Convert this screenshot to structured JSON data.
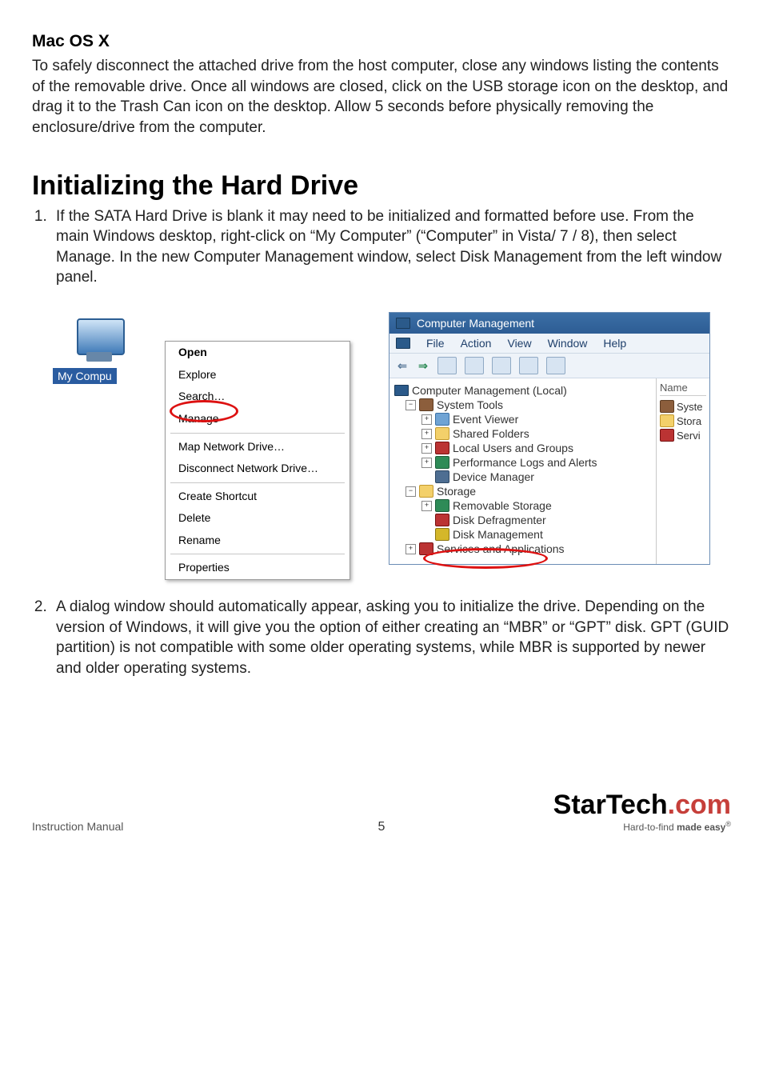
{
  "section1_title": "Mac OS X",
  "section1_body": "To safely disconnect the attached drive from the host computer, close any windows listing the contents of the removable drive. Once all windows are closed, click on the USB storage icon on the desktop, and drag it to the Trash Can icon on the desktop. Allow 5 seconds before physically removing the enclosure/drive from the computer.",
  "main_title": "Initializing the Hard Drive",
  "step1": "If the SATA Hard Drive is blank it may need to be initialized and formatted before use. From the main Windows desktop, right-click on “My Computer” (“Computer” in Vista/ 7 / 8), then select Manage. In the new Computer Management window, select Disk Management from the left window panel.",
  "step2": "A dialog window should automatically appear, asking you to initialize the drive. Depending on the version of Windows, it will give you the option of either creating an “MBR” or “GPT” disk. GPT (GUID partition) is not compatible with some older operating systems, while MBR is supported by newer and older operating systems.",
  "mycomputer_label": "My Compu",
  "context_menu": {
    "open": "Open",
    "explore": "Explore",
    "search": "Search…",
    "manage": "Manage",
    "map": "Map Network Drive…",
    "disconnect": "Disconnect Network Drive…",
    "shortcut": "Create Shortcut",
    "delete": "Delete",
    "rename": "Rename",
    "properties": "Properties"
  },
  "mgmt": {
    "title": "Computer Management",
    "menu": {
      "file": "File",
      "action": "Action",
      "view": "View",
      "window": "Window",
      "help": "Help"
    },
    "tree": {
      "root": "Computer Management (Local)",
      "systools": "System Tools",
      "eventviewer": "Event Viewer",
      "shared": "Shared Folders",
      "users": "Local Users and Groups",
      "perf": "Performance Logs and Alerts",
      "devmgr": "Device Manager",
      "storage": "Storage",
      "removable": "Removable Storage",
      "defrag": "Disk Defragmenter",
      "diskmgmt": "Disk Management",
      "services": "Services and Applications"
    },
    "right": {
      "header": "Name",
      "r1": "Syste",
      "r2": "Stora",
      "r3": "Servi"
    }
  },
  "footer": {
    "left": "Instruction Manual",
    "page": "5",
    "logo_main": "StarTech",
    "logo_dotcom": ".com",
    "logo_tag_1": "Hard-to-find ",
    "logo_tag_2": "made easy"
  }
}
